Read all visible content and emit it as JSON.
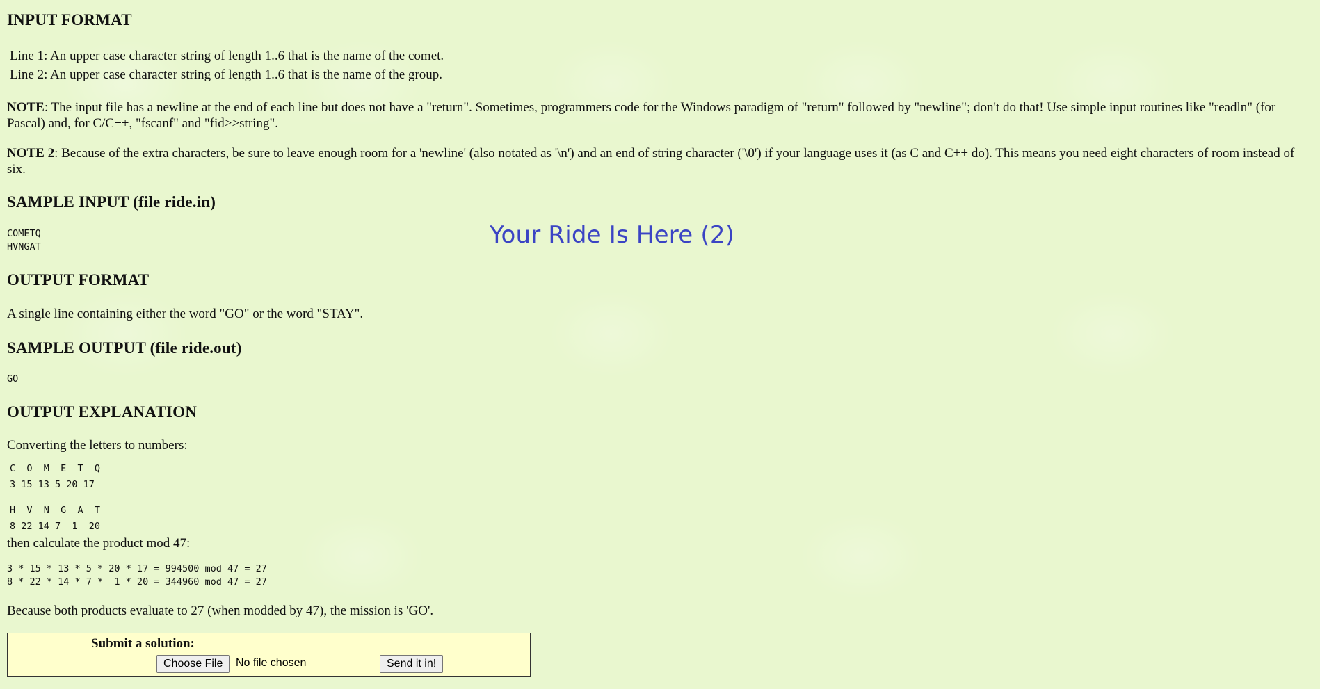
{
  "overlay": {
    "title": "Your Ride Is Here (2)"
  },
  "input_format": {
    "heading": "INPUT FORMAT",
    "lines": [
      "Line 1: An upper case character string of length 1..6 that is the name of the comet.",
      "Line 2: An upper case character string of length 1..6 that is the name of the group."
    ],
    "note_label": "NOTE",
    "note_text": ": The input file has a newline at the end of each line but does not have a \"return\". Sometimes, programmers code for the Windows paradigm of \"return\" followed by \"newline\"; don't do that! Use simple input routines like \"readln\" (for Pascal) and, for C/C++, \"fscanf\" and \"fid>>string\".",
    "note2_label": "NOTE 2",
    "note2_text": ": Because of the extra characters, be sure to leave enough room for a 'newline' (also notated as '\\n') and an end of string character ('\\0') if your language uses it (as C and C++ do). This means you need eight characters of room instead of six."
  },
  "sample_input": {
    "heading": "SAMPLE INPUT (file ride.in)",
    "lines": [
      "COMETQ",
      "HVNGAT"
    ]
  },
  "output_format": {
    "heading": "OUTPUT FORMAT",
    "text": "A single line containing either the word \"GO\" or the word \"STAY\"."
  },
  "sample_output": {
    "heading": "SAMPLE OUTPUT (file ride.out)",
    "value": "GO"
  },
  "explanation": {
    "heading": "OUTPUT EXPLANATION",
    "intro": "Converting the letters to numbers:",
    "comet_letters": "C  O  M  E  T  Q",
    "comet_numbers": "3 15 13 5 20 17",
    "group_letters": "H  V  N  G  A  T",
    "group_numbers": "8 22 14 7  1  20",
    "then": "then calculate the product mod 47:",
    "calc1": "3 * 15 * 13 * 5 * 20 * 17 = 994500 mod 47 = 27",
    "calc2": "8 * 22 * 14 * 7 *  1 * 20 = 344960 mod 47 = 27",
    "conclusion": "Because both products evaluate to 27 (when modded by 47), the mission is 'GO'."
  },
  "submit": {
    "title": "Submit a solution:",
    "choose_label": "Choose File",
    "file_status": "No file chosen",
    "send_label": "Send it in!"
  }
}
